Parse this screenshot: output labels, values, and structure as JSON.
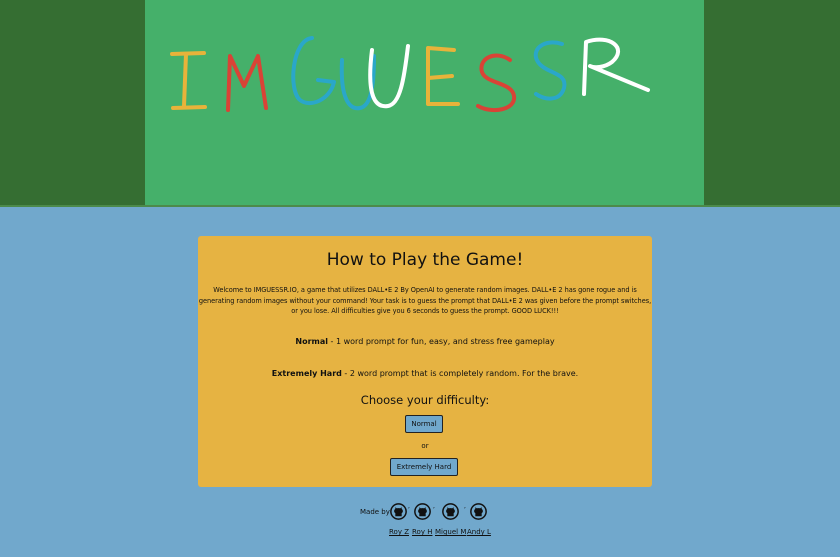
{
  "logo": {
    "text": "IMGUESSR",
    "colors": {
      "I": "#e8b33a",
      "M": "#d94336",
      "G": "#2aa7c9",
      "U": "#2aa7c9",
      "E": "#e8b33a",
      "S1": "#d94336",
      "S2": "#2aa7c9",
      "R": "#ffffff"
    }
  },
  "colors": {
    "top_band": "#356e32",
    "header": "#45b06a",
    "page_bg": "#71a8cc",
    "card": "#e6b342",
    "button": "#71a8cc"
  },
  "card": {
    "title": "How to Play the Game!",
    "intro": "Welcome to IMGUESSR.IO, a game that utilizes DALL•E 2 By OpenAI to generate random images. DALL•E 2 has gone rogue and is generating random images without your command! Your task is to guess the prompt that DALL•E 2 was given before the prompt switches, or you lose. All difficulties give you 6 seconds to guess the prompt. GOOD LUCK!!!",
    "normal_label": "Normal",
    "normal_desc": " - 1 word prompt for fun, easy, and stress free gameplay",
    "hard_label": "Extremely Hard",
    "hard_desc": " - 2 word prompt that is completely random. For the brave.",
    "choose": "Choose your difficulty:",
    "normal_button": "Normal",
    "or": "or",
    "hard_button": "Extremely Hard"
  },
  "footer": {
    "made_by": "Made by",
    "separator": ",",
    "authors": [
      "Roy Z",
      "Roy H",
      "Miguel M",
      "Andy L"
    ]
  }
}
